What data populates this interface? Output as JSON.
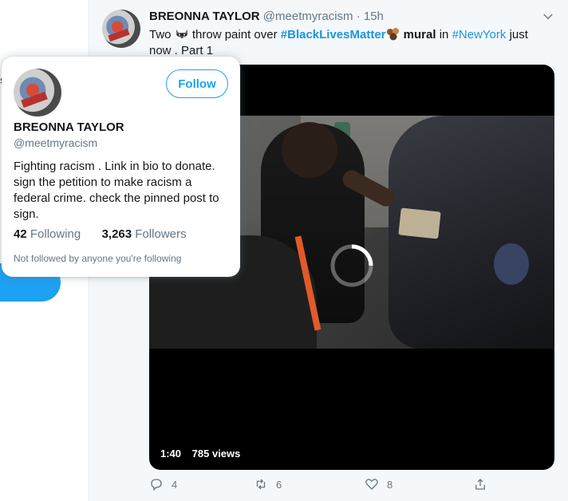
{
  "background": {
    "partial_letter": "s"
  },
  "tweet": {
    "author_name": "BREONNA TAYLOR",
    "author_handle": "@meetmyracism",
    "separator": "·",
    "time": "15h",
    "text_part1": "Two",
    "raccoon_icon": "raccoon-emoji",
    "text_part2": "throw paint over",
    "hashtag1": "#BlackLivesMatter",
    "fist_icon": "raised-fists-emoji",
    "text_part3": "mural",
    "text_part4": "in",
    "hashtag2": "#NewYork",
    "text_part5": "just now . Part 1",
    "video": {
      "duration": "1:40",
      "views": "785 views"
    },
    "actions": {
      "replies": "4",
      "retweets": "6",
      "likes": "8"
    }
  },
  "hovercard": {
    "name": "BREONNA TAYLOR",
    "handle": "@meetmyracism",
    "follow_label": "Follow",
    "bio": "Fighting racism . Link in bio to donate. sign the petition to make racism a federal crime. check the pinned post to sign.",
    "following_count": "42",
    "following_label": "Following",
    "followers_count": "3,263",
    "followers_label": "Followers",
    "note": "Not followed by anyone you're following"
  },
  "colors": {
    "accent": "#1da1f2",
    "hashtag": "#1b95e0",
    "muted": "#657786"
  }
}
